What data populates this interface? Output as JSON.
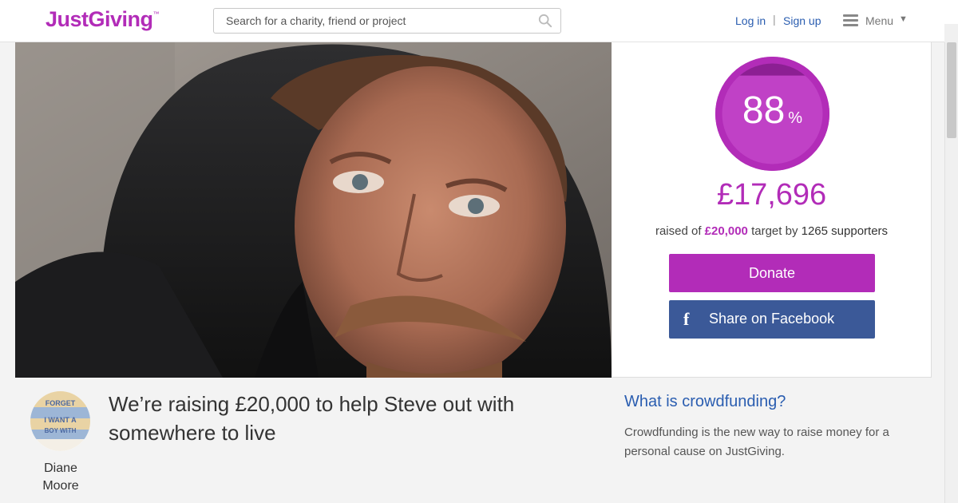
{
  "header": {
    "logo": "JustGiving",
    "logo_tm": "™",
    "search_placeholder": "Search for a charity, friend or project",
    "login_label": "Log in",
    "separator": "|",
    "signup_label": "Sign up",
    "menu_label": "Menu",
    "search_icon": "search-icon",
    "menu_icon": "hamburger-icon"
  },
  "hero": {
    "image": "photo of Steve"
  },
  "stats": {
    "percent": "88",
    "percent_symbol": "%",
    "percent_value": 0.88,
    "raised": "£17,696",
    "raised_of": "raised of",
    "target": "£20,000",
    "target_by": "target by",
    "supporters": "1265 supporters",
    "donate_label": "Donate",
    "facebook_label": "Share on Facebook",
    "facebook_icon": "f"
  },
  "page": {
    "headline": "We’re raising £20,000 to help Steve out with somewhere to live",
    "owner_first": "Diane",
    "owner_last": "Moore",
    "avatar_text": [
      "FORGET",
      "I WANT A",
      "BOY WITH"
    ]
  },
  "info": {
    "title": "What is crowdfunding?",
    "text": "Crowdfunding is the new way to raise money for a personal cause on JustGiving."
  },
  "colors": {
    "brand": "#b22cb8",
    "link": "#2a5db0",
    "facebook": "#3b5998"
  }
}
